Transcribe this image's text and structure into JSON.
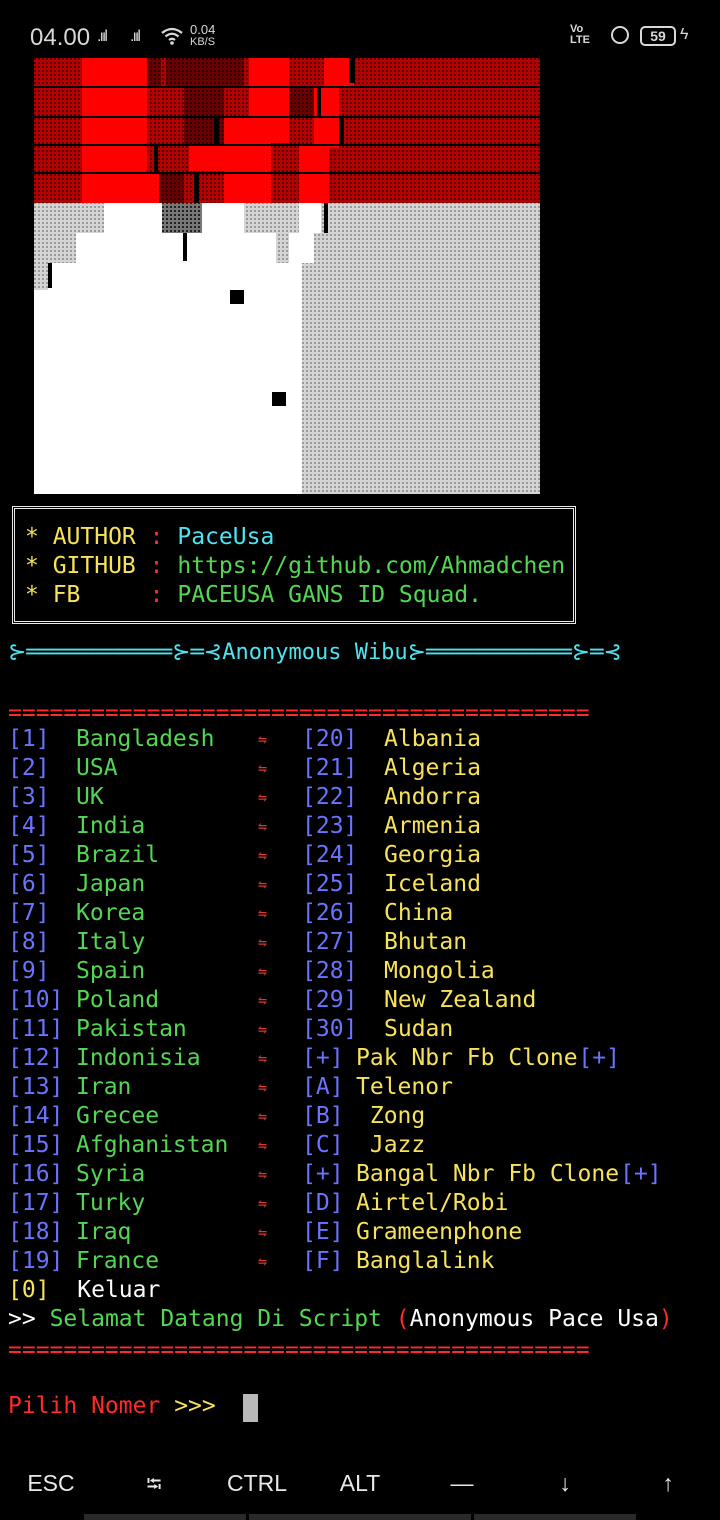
{
  "status_bar": {
    "time": "04.00",
    "signal1": ".ııl",
    "signal2": ".ııl",
    "net_speed": "0.04",
    "net_unit": "KB/S",
    "volte_top": "Vo",
    "volte_bottom": "LTE",
    "battery": "59",
    "icons": [
      "wifi-icon",
      "lock-icon",
      "battery-icon",
      "charging-icon"
    ]
  },
  "banner": {
    "colors": {
      "red": "#ff0000",
      "white": "#ffffff",
      "shade": "#c8c8c8"
    }
  },
  "info": {
    "author_key": "* AUTHOR",
    "author_sep": ":",
    "author_val": "PaceUsa",
    "github_key": "* GITHUB",
    "github_sep": ":",
    "github_val": "https://github.com/Ahmadchen",
    "fb_key": "* FB",
    "fb_sep": ":",
    "fb_val": "PACEUSA GANS ID Squad."
  },
  "divider_title": "⊱═══════════⊱═⊰Anonymous Wibu⊱═══════════⊱═⊰",
  "separator": "==========================================",
  "menu_left": [
    {
      "num": "[1]",
      "name": "Bangladesh"
    },
    {
      "num": "[2]",
      "name": "USA"
    },
    {
      "num": "[3]",
      "name": "UK"
    },
    {
      "num": "[4]",
      "name": "India"
    },
    {
      "num": "[5]",
      "name": "Brazil"
    },
    {
      "num": "[6]",
      "name": "Japan"
    },
    {
      "num": "[7]",
      "name": "Korea"
    },
    {
      "num": "[8]",
      "name": "Italy"
    },
    {
      "num": "[9]",
      "name": "Spain"
    },
    {
      "num": "[10]",
      "name": "Poland"
    },
    {
      "num": "[11]",
      "name": "Pakistan"
    },
    {
      "num": "[12]",
      "name": "Indonisia"
    },
    {
      "num": "[13]",
      "name": "Iran"
    },
    {
      "num": "[14]",
      "name": "Grecee"
    },
    {
      "num": "[15]",
      "name": "Afghanistan"
    },
    {
      "num": "[16]",
      "name": "Syria"
    },
    {
      "num": "[17]",
      "name": "Turky"
    },
    {
      "num": "[18]",
      "name": "Iraq"
    },
    {
      "num": "[19]",
      "name": "France"
    }
  ],
  "menu_sep": "⇋",
  "menu_right": [
    {
      "num": "[20]",
      "name": "Albania"
    },
    {
      "num": "[21]",
      "name": "Algeria"
    },
    {
      "num": "[22]",
      "name": "Andorra"
    },
    {
      "num": "[23]",
      "name": "Armenia"
    },
    {
      "num": "[24]",
      "name": "Georgia"
    },
    {
      "num": "[25]",
      "name": "Iceland"
    },
    {
      "num": "[26]",
      "name": "China"
    },
    {
      "num": "[27]",
      "name": "Bhutan"
    },
    {
      "num": "[28]",
      "name": "Mongolia"
    },
    {
      "num": "[29]",
      "name": "New Zealand"
    },
    {
      "num": "[30]",
      "name": "Sudan"
    },
    {
      "num": "[+]",
      "name": "Pak Nbr Fb Clone",
      "suffix": "[+]"
    },
    {
      "num": "[A]",
      "name": "Telenor"
    },
    {
      "num": "[B]",
      "name": " Zong"
    },
    {
      "num": "[C]",
      "name": " Jazz"
    },
    {
      "num": "[+]",
      "name": "Bangal Nbr Fb Clone",
      "suffix": "[+]"
    },
    {
      "num": "[D]",
      "name": "Airtel/Robi"
    },
    {
      "num": "[E]",
      "name": "Grameenphone"
    },
    {
      "num": "[F]",
      "name": "Banglalink"
    }
  ],
  "exit_option": {
    "num": "[0]",
    "name": "Keluar"
  },
  "welcome": {
    "prefix": ">>",
    "text": "Selamat Datang Di Script",
    "open_paren": "(",
    "name": "Anonymous Pace Usa",
    "close_paren": ")"
  },
  "prompt": {
    "label": "Pilih Nomer",
    "arrows": ">>>"
  },
  "extra_keys": [
    "ESC",
    "⭾",
    "CTRL",
    "ALT",
    "—",
    "↓",
    "↑"
  ]
}
